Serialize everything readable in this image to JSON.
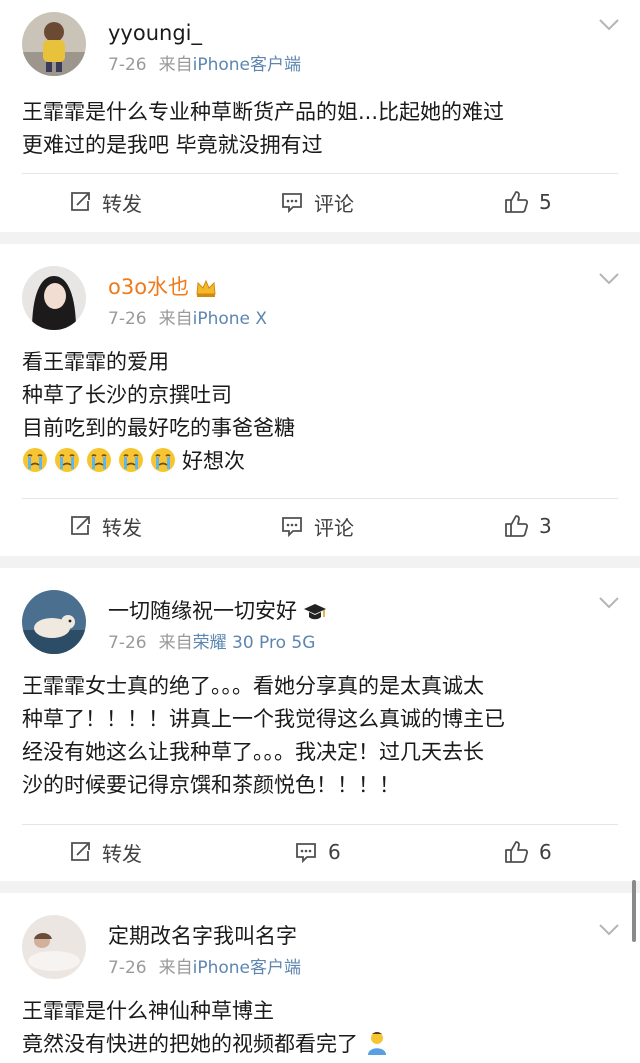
{
  "comments": [
    {
      "username": "yyoungi_",
      "date": "7-26",
      "source_prefix": "来自",
      "source": "iPhone客户端",
      "lines": [
        "王霏霏是什么专业种草断货产品的姐...比起她的难过",
        "更难过的是我吧 毕竟就没拥有过"
      ],
      "actions": {
        "repost": "转发",
        "comment": "评论",
        "likes": "5"
      }
    },
    {
      "username": "o3o水也",
      "date": "7-26",
      "source_prefix": "来自",
      "source": "iPhone X",
      "lines": [
        "看王霏霏的爱用",
        "种草了长沙的京撰吐司",
        "目前吃到的最好吃的事爸爸糖",
        "好想次"
      ],
      "emoji": "crying-face",
      "emoji_count": 5,
      "actions": {
        "repost": "转发",
        "comment": "评论",
        "likes": "3"
      }
    },
    {
      "username": "一切随缘祝一切安好",
      "date": "7-26",
      "source_prefix": "来自",
      "source": "荣耀 30 Pro 5G",
      "lines": [
        "王霏霏女士真的绝了。。。看她分享真的是太真诚太",
        "种草了！！！！讲真上一个我觉得这么真诚的博主已",
        "经没有她这么让我种草了。。。我决定！过几天去长",
        "沙的时候要记得京馔和茶颜悦色！！！！"
      ],
      "actions": {
        "repost": "转发",
        "comment": "6",
        "likes": "6"
      }
    },
    {
      "username": "定期改名字我叫名字",
      "date": "7-26",
      "source_prefix": "来自",
      "source": "iPhone客户端",
      "lines": [
        "王霏霏是什么神仙种草博主",
        "竟然没有快进的把她的视频都看完了"
      ]
    }
  ],
  "colors": {
    "orange_name": "#f07a1a",
    "source_link": "#5c86b0",
    "meta_gray": "#9a9a9a",
    "separator": "#f2f2f2"
  }
}
